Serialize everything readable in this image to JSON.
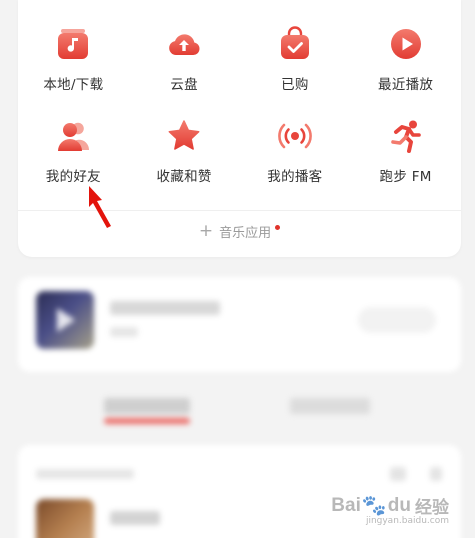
{
  "colors": {
    "accent": "#e8453c",
    "accent_light": "#f37a6d",
    "text": "#333333",
    "muted": "#9a9a9a",
    "background": "#f3f3f3"
  },
  "quick_actions": {
    "row1": [
      {
        "label": "本地/下载",
        "icon": "music-note-folder-icon"
      },
      {
        "label": "云盘",
        "icon": "cloud-upload-icon"
      },
      {
        "label": "已购",
        "icon": "shopping-bag-check-icon"
      },
      {
        "label": "最近播放",
        "icon": "play-circle-icon"
      }
    ],
    "row2": [
      {
        "label": "我的好友",
        "icon": "friends-icon"
      },
      {
        "label": "收藏和赞",
        "icon": "star-icon"
      },
      {
        "label": "我的播客",
        "icon": "broadcast-icon"
      },
      {
        "label": "跑步 FM",
        "icon": "running-icon"
      }
    ]
  },
  "music_apps": {
    "label": "音乐应用",
    "has_notification": true
  },
  "watermark": {
    "brand": "Bai",
    "brand2": "du",
    "jingyan": "经验",
    "url": "jingyan.baidu.com"
  }
}
